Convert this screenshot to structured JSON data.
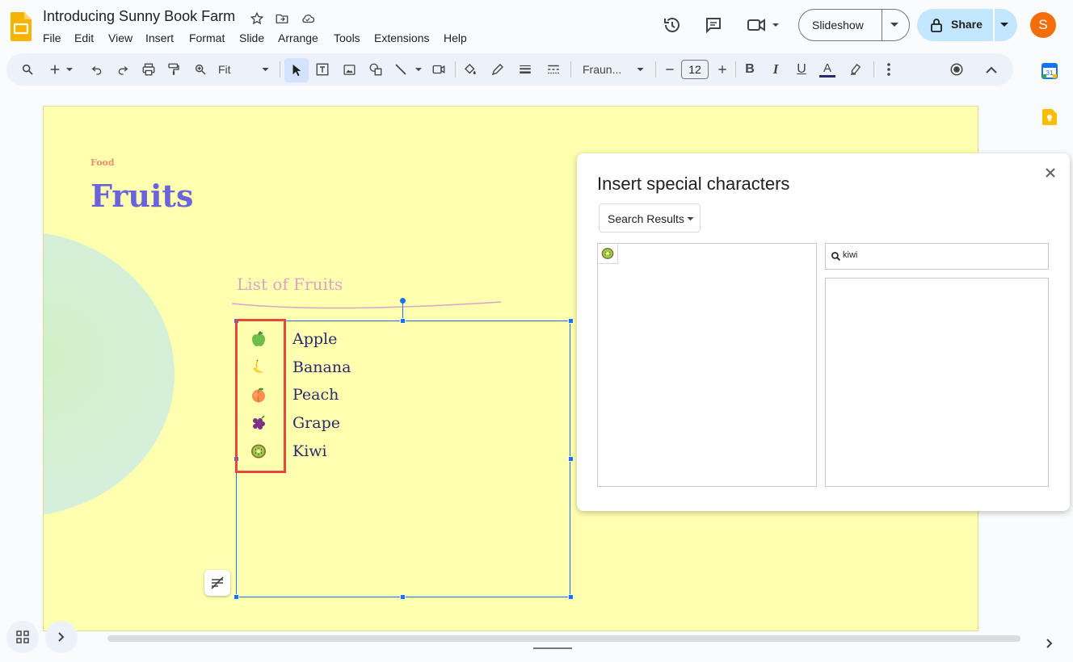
{
  "header": {
    "title": "Introducing Sunny Book Farm",
    "menu": [
      "File",
      "Edit",
      "View",
      "Insert",
      "Format",
      "Slide",
      "Arrange",
      "Tools",
      "Extensions",
      "Help"
    ],
    "slideshow_label": "Slideshow",
    "share_label": "Share",
    "avatar_letter": "S"
  },
  "toolbar": {
    "zoom_value": "Fit",
    "font_name": "Fraun...",
    "font_size": "12"
  },
  "slide": {
    "kicker": "Food",
    "title": "Fruits",
    "subtitle": "List of Fruits",
    "fruits": [
      {
        "emoji": "🍏",
        "name": "Apple"
      },
      {
        "emoji": "🍌",
        "name": "Banana"
      },
      {
        "emoji": "🍑",
        "name": "Peach"
      },
      {
        "emoji": "🍇",
        "name": "Grape"
      },
      {
        "emoji": "🥝",
        "name": "Kiwi"
      }
    ]
  },
  "dialog": {
    "title": "Insert special characters",
    "category_value": "Search Results",
    "search_value": "kiwi",
    "result_chars": [
      "🥝"
    ]
  },
  "colors": {
    "slide_bg": "#ffffb0",
    "title_color": "#6b63d9",
    "accent_share": "#c2e7ff",
    "avatar": "#f46d0b",
    "selection": "#1a73e8",
    "highlight_box": "#e8473f"
  }
}
